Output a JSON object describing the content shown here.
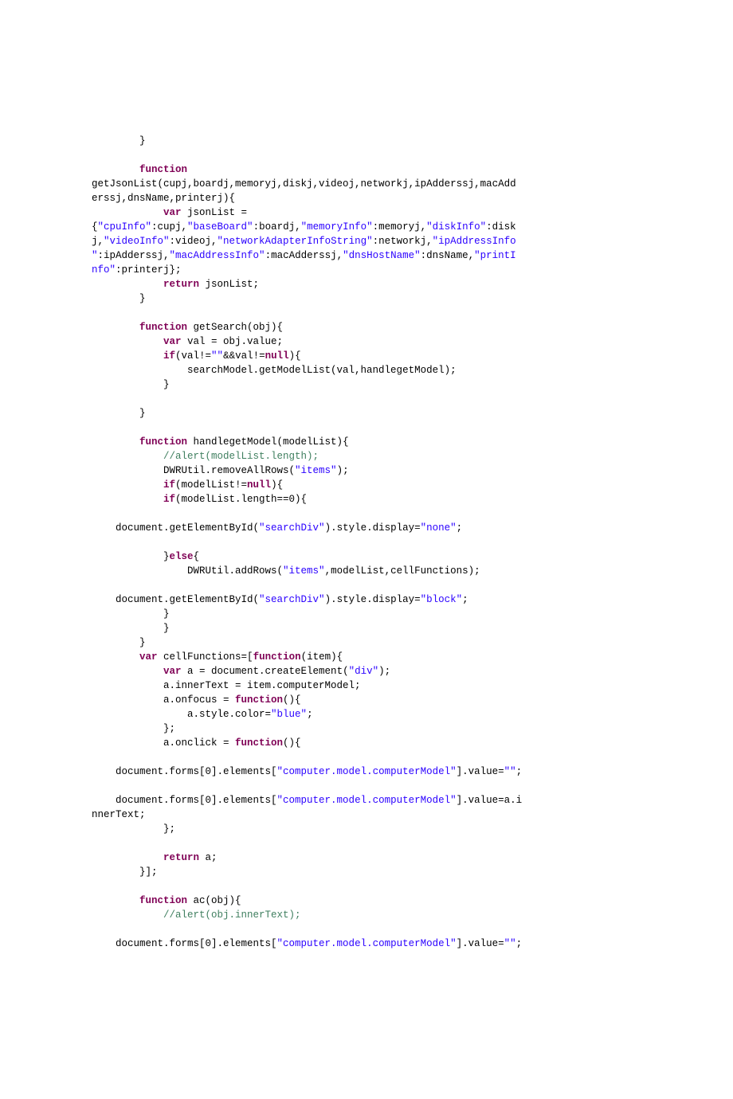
{
  "code": {
    "tokens": [
      {
        "t": "        }\n",
        "c": "pl"
      },
      {
        "t": "\n",
        "c": "pl"
      },
      {
        "t": "        ",
        "c": "pl"
      },
      {
        "t": "function",
        "c": "kw"
      },
      {
        "t": "\n",
        "c": "pl"
      },
      {
        "t": "getJsonList(cupj,boardj,memoryj,diskj,videoj,networkj,ipAdderssj,macAdd\n",
        "c": "pl"
      },
      {
        "t": "erssj,dnsName,printerj){\n",
        "c": "pl"
      },
      {
        "t": "            ",
        "c": "pl"
      },
      {
        "t": "var",
        "c": "kw"
      },
      {
        "t": " jsonList =\n",
        "c": "pl"
      },
      {
        "t": "{",
        "c": "pl"
      },
      {
        "t": "\"cpuInfo\"",
        "c": "str"
      },
      {
        "t": ":cupj,",
        "c": "pl"
      },
      {
        "t": "\"baseBoard\"",
        "c": "str"
      },
      {
        "t": ":boardj,",
        "c": "pl"
      },
      {
        "t": "\"memoryInfo\"",
        "c": "str"
      },
      {
        "t": ":memoryj,",
        "c": "pl"
      },
      {
        "t": "\"diskInfo\"",
        "c": "str"
      },
      {
        "t": ":disk\n",
        "c": "pl"
      },
      {
        "t": "j,",
        "c": "pl"
      },
      {
        "t": "\"videoInfo\"",
        "c": "str"
      },
      {
        "t": ":videoj,",
        "c": "pl"
      },
      {
        "t": "\"networkAdapterInfoString\"",
        "c": "str"
      },
      {
        "t": ":networkj,",
        "c": "pl"
      },
      {
        "t": "\"ipAddressInfo\n",
        "c": "str"
      },
      {
        "t": "\"",
        "c": "str"
      },
      {
        "t": ":ipAdderssj,",
        "c": "pl"
      },
      {
        "t": "\"macAddressInfo\"",
        "c": "str"
      },
      {
        "t": ":macAdderssj,",
        "c": "pl"
      },
      {
        "t": "\"dnsHostName\"",
        "c": "str"
      },
      {
        "t": ":dnsName,",
        "c": "pl"
      },
      {
        "t": "\"printI\n",
        "c": "str"
      },
      {
        "t": "nfo\"",
        "c": "str"
      },
      {
        "t": ":printerj};\n",
        "c": "pl"
      },
      {
        "t": "            ",
        "c": "pl"
      },
      {
        "t": "return",
        "c": "kw"
      },
      {
        "t": " jsonList;\n",
        "c": "pl"
      },
      {
        "t": "        }\n",
        "c": "pl"
      },
      {
        "t": "\n",
        "c": "pl"
      },
      {
        "t": "        ",
        "c": "pl"
      },
      {
        "t": "function",
        "c": "kw"
      },
      {
        "t": " getSearch(obj){\n",
        "c": "pl"
      },
      {
        "t": "            ",
        "c": "pl"
      },
      {
        "t": "var",
        "c": "kw"
      },
      {
        "t": " val = obj.value;\n",
        "c": "pl"
      },
      {
        "t": "            ",
        "c": "pl"
      },
      {
        "t": "if",
        "c": "kw"
      },
      {
        "t": "(val!=",
        "c": "pl"
      },
      {
        "t": "\"\"",
        "c": "str"
      },
      {
        "t": "&&val!=",
        "c": "pl"
      },
      {
        "t": "null",
        "c": "kw"
      },
      {
        "t": "){\n",
        "c": "pl"
      },
      {
        "t": "                searchModel.getModelList(val,handlegetModel);\n",
        "c": "pl"
      },
      {
        "t": "            }\n",
        "c": "pl"
      },
      {
        "t": "\n",
        "c": "pl"
      },
      {
        "t": "        }\n",
        "c": "pl"
      },
      {
        "t": "\n",
        "c": "pl"
      },
      {
        "t": "        ",
        "c": "pl"
      },
      {
        "t": "function",
        "c": "kw"
      },
      {
        "t": " handlegetModel(modelList){\n",
        "c": "pl"
      },
      {
        "t": "            ",
        "c": "pl"
      },
      {
        "t": "//alert(modelList.length);",
        "c": "cmt"
      },
      {
        "t": "\n",
        "c": "pl"
      },
      {
        "t": "            DWRUtil.removeAllRows(",
        "c": "pl"
      },
      {
        "t": "\"items\"",
        "c": "str"
      },
      {
        "t": ");\n",
        "c": "pl"
      },
      {
        "t": "            ",
        "c": "pl"
      },
      {
        "t": "if",
        "c": "kw"
      },
      {
        "t": "(modelList!=",
        "c": "pl"
      },
      {
        "t": "null",
        "c": "kw"
      },
      {
        "t": "){\n",
        "c": "pl"
      },
      {
        "t": "            ",
        "c": "pl"
      },
      {
        "t": "if",
        "c": "kw"
      },
      {
        "t": "(modelList.length==0){\n",
        "c": "pl"
      },
      {
        "t": "\n",
        "c": "pl"
      },
      {
        "t": "    document.getElementById(",
        "c": "pl"
      },
      {
        "t": "\"searchDiv\"",
        "c": "str"
      },
      {
        "t": ").style.display=",
        "c": "pl"
      },
      {
        "t": "\"none\"",
        "c": "str"
      },
      {
        "t": ";\n",
        "c": "pl"
      },
      {
        "t": "\n",
        "c": "pl"
      },
      {
        "t": "            }",
        "c": "pl"
      },
      {
        "t": "else",
        "c": "kw"
      },
      {
        "t": "{\n",
        "c": "pl"
      },
      {
        "t": "                DWRUtil.addRows(",
        "c": "pl"
      },
      {
        "t": "\"items\"",
        "c": "str"
      },
      {
        "t": ",modelList,cellFunctions);\n",
        "c": "pl"
      },
      {
        "t": "\n",
        "c": "pl"
      },
      {
        "t": "    document.getElementById(",
        "c": "pl"
      },
      {
        "t": "\"searchDiv\"",
        "c": "str"
      },
      {
        "t": ").style.display=",
        "c": "pl"
      },
      {
        "t": "\"block\"",
        "c": "str"
      },
      {
        "t": ";\n",
        "c": "pl"
      },
      {
        "t": "            }\n",
        "c": "pl"
      },
      {
        "t": "            }\n",
        "c": "pl"
      },
      {
        "t": "        }\n",
        "c": "pl"
      },
      {
        "t": "        ",
        "c": "pl"
      },
      {
        "t": "var",
        "c": "kw"
      },
      {
        "t": " cellFunctions=[",
        "c": "pl"
      },
      {
        "t": "function",
        "c": "kw"
      },
      {
        "t": "(item){\n",
        "c": "pl"
      },
      {
        "t": "            ",
        "c": "pl"
      },
      {
        "t": "var",
        "c": "kw"
      },
      {
        "t": " a = document.createElement(",
        "c": "pl"
      },
      {
        "t": "\"div\"",
        "c": "str"
      },
      {
        "t": ");\n",
        "c": "pl"
      },
      {
        "t": "            a.innerText = item.computerModel;\n",
        "c": "pl"
      },
      {
        "t": "            a.onfocus = ",
        "c": "pl"
      },
      {
        "t": "function",
        "c": "kw"
      },
      {
        "t": "(){\n",
        "c": "pl"
      },
      {
        "t": "                a.style.color=",
        "c": "pl"
      },
      {
        "t": "\"blue\"",
        "c": "str"
      },
      {
        "t": ";\n",
        "c": "pl"
      },
      {
        "t": "            };\n",
        "c": "pl"
      },
      {
        "t": "            a.onclick = ",
        "c": "pl"
      },
      {
        "t": "function",
        "c": "kw"
      },
      {
        "t": "(){\n",
        "c": "pl"
      },
      {
        "t": "\n",
        "c": "pl"
      },
      {
        "t": "    document.forms[0].elements[",
        "c": "pl"
      },
      {
        "t": "\"computer.model.computerModel\"",
        "c": "str"
      },
      {
        "t": "].value=",
        "c": "pl"
      },
      {
        "t": "\"\"",
        "c": "str"
      },
      {
        "t": ";\n",
        "c": "pl"
      },
      {
        "t": "\n",
        "c": "pl"
      },
      {
        "t": "    document.forms[0].elements[",
        "c": "pl"
      },
      {
        "t": "\"computer.model.computerModel\"",
        "c": "str"
      },
      {
        "t": "].value=a.i\n",
        "c": "pl"
      },
      {
        "t": "nnerText;\n",
        "c": "pl"
      },
      {
        "t": "            };\n",
        "c": "pl"
      },
      {
        "t": "\n",
        "c": "pl"
      },
      {
        "t": "            ",
        "c": "pl"
      },
      {
        "t": "return",
        "c": "kw"
      },
      {
        "t": " a;\n",
        "c": "pl"
      },
      {
        "t": "        }];\n",
        "c": "pl"
      },
      {
        "t": "\n",
        "c": "pl"
      },
      {
        "t": "        ",
        "c": "pl"
      },
      {
        "t": "function",
        "c": "kw"
      },
      {
        "t": " ac(obj){\n",
        "c": "pl"
      },
      {
        "t": "            ",
        "c": "pl"
      },
      {
        "t": "//alert(obj.innerText);",
        "c": "cmt"
      },
      {
        "t": "\n",
        "c": "pl"
      },
      {
        "t": "\n",
        "c": "pl"
      },
      {
        "t": "    document.forms[0].elements[",
        "c": "pl"
      },
      {
        "t": "\"computer.model.computerModel\"",
        "c": "str"
      },
      {
        "t": "].value=",
        "c": "pl"
      },
      {
        "t": "\"\"",
        "c": "str"
      },
      {
        "t": ";\n",
        "c": "pl"
      }
    ]
  }
}
